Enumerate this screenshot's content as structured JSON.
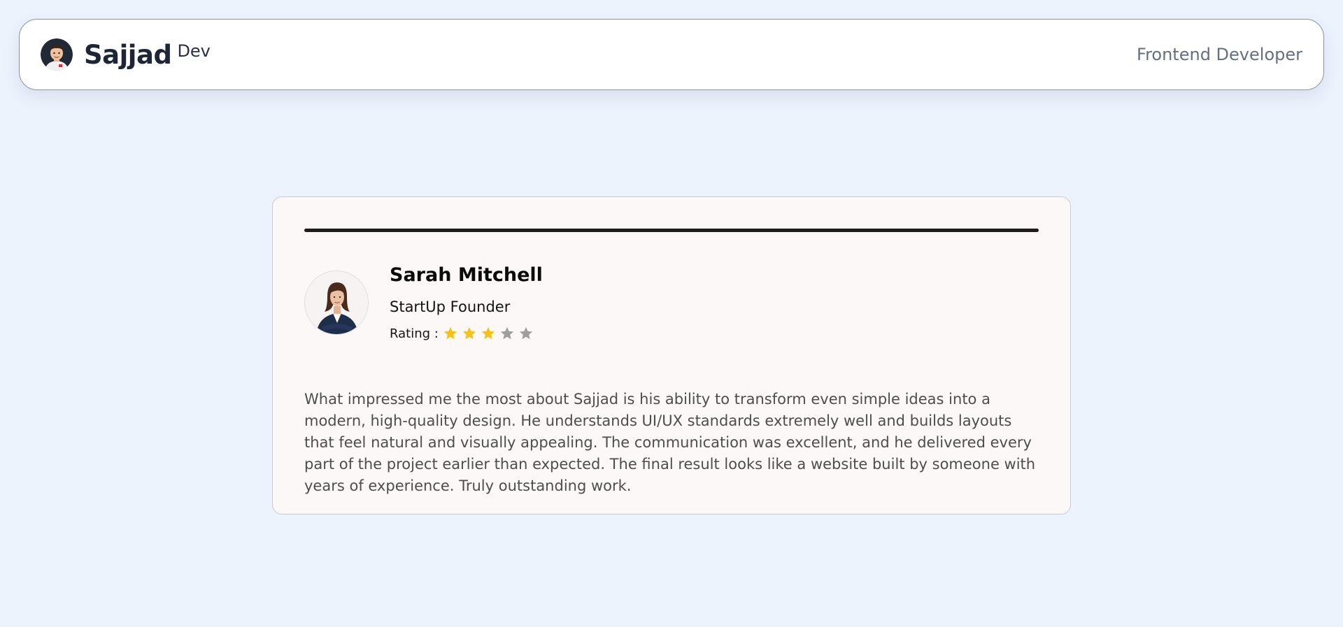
{
  "header": {
    "brand_name": "Sajjad",
    "brand_suffix": "Dev",
    "role": "Frontend Developer",
    "avatar_icon": "developer-avatar-icon"
  },
  "testimonial": {
    "name": "Sarah Mitchell",
    "title": "StartUp Founder",
    "rating_label": "Rating :",
    "rating": 3,
    "rating_max": 5,
    "avatar_icon": "businesswoman-avatar-icon",
    "review": "What impressed me the most about Sajjad is his ability to transform even simple ideas into a modern, high-quality design. He understands UI/UX standards extremely well and builds layouts that feel natural and visually appealing. The communication was excellent, and he delivered every part of the project earlier than expected. The final result looks like a website built by someone with years of experience. Truly outstanding work."
  },
  "colors": {
    "page_background": "#edf3fd",
    "card_background": "#fcf8f7",
    "star_filled": "#f6c21a",
    "star_empty": "#9e9e9e",
    "role_text": "#64707f"
  }
}
